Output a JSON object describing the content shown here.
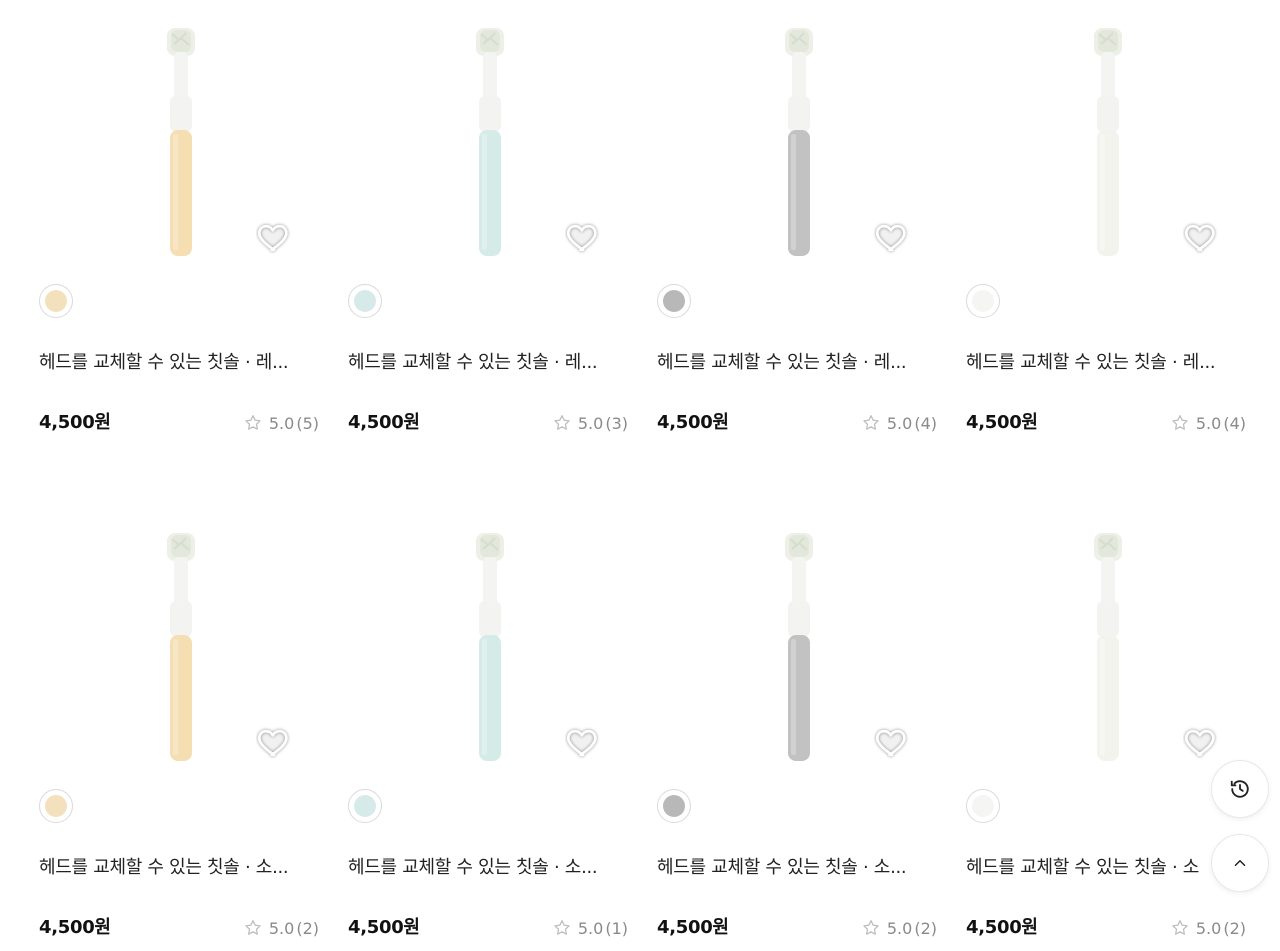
{
  "products": [
    {
      "title": "헤드를 교체할 수 있는 칫솔 · 레...",
      "price": "4,500원",
      "rating": "5.0",
      "count": "(5)",
      "color": "#f3e1bd",
      "handle": "#f5deb2",
      "swatch_name": "beige"
    },
    {
      "title": "헤드를 교체할 수 있는 칫솔 · 레...",
      "price": "4,500원",
      "rating": "5.0",
      "count": "(3)",
      "color": "#d7eaea",
      "handle": "#d5ebe8",
      "swatch_name": "mint"
    },
    {
      "title": "헤드를 교체할 수 있는 칫솔 · 레...",
      "price": "4,500원",
      "rating": "5.0",
      "count": "(4)",
      "color": "#b8b8b8",
      "handle": "#c2c2c2",
      "swatch_name": "gray"
    },
    {
      "title": "헤드를 교체할 수 있는 칫솔 · 레...",
      "price": "4,500원",
      "rating": "5.0",
      "count": "(4)",
      "color": "#f5f5f3",
      "handle": "#f3f3ee",
      "swatch_name": "white"
    },
    {
      "title": "헤드를 교체할 수 있는 칫솔 · 소...",
      "price": "4,500원",
      "rating": "5.0",
      "count": "(2)",
      "color": "#f3e1bd",
      "handle": "#f5deb2",
      "swatch_name": "beige"
    },
    {
      "title": "헤드를 교체할 수 있는 칫솔 · 소...",
      "price": "4,500원",
      "rating": "5.0",
      "count": "(1)",
      "color": "#d7eaea",
      "handle": "#d5ebe8",
      "swatch_name": "mint"
    },
    {
      "title": "헤드를 교체할 수 있는 칫솔 · 소...",
      "price": "4,500원",
      "rating": "5.0",
      "count": "(2)",
      "color": "#b8b8b8",
      "handle": "#c2c2c2",
      "swatch_name": "gray"
    },
    {
      "title": "헤드를 교체할 수 있는 칫솔 · 소",
      "price": "4,500원",
      "rating": "5.0",
      "count": "(2)",
      "color": "#f5f5f3",
      "handle": "#f3f3ee",
      "swatch_name": "white"
    }
  ],
  "floating_buttons": {
    "recent_icon": "history-icon",
    "top_icon": "chevron-up-icon"
  },
  "colors": {
    "star": "#bdbdbd",
    "heart": "#ffffff",
    "rating_text": "#8a8a8a"
  }
}
